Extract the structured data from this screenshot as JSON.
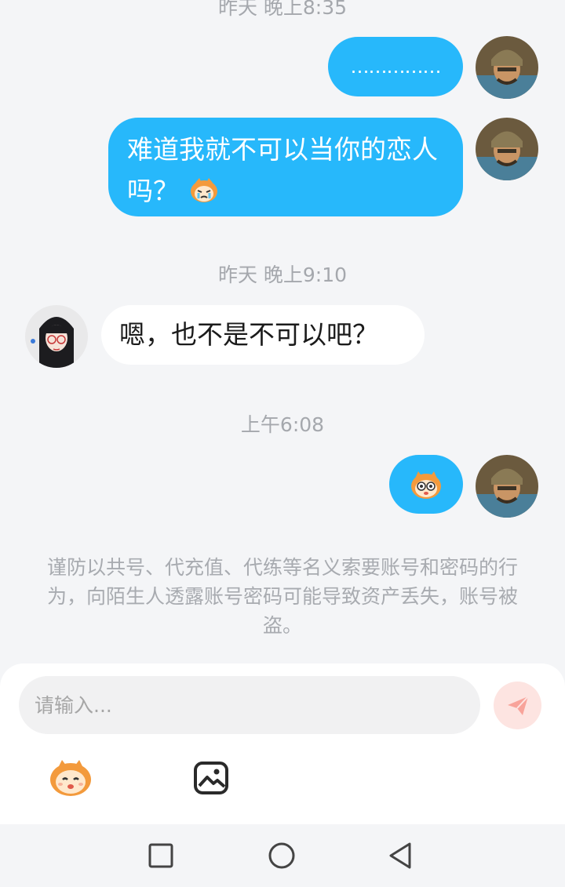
{
  "messages": {
    "ts1": "昨天 晚上8:35",
    "m1_text": "……………",
    "m2_text": "难道我就不可以当你的恋人吗？",
    "ts2": "昨天 晚上9:10",
    "m3_text": "嗯，也不是不可以吧？",
    "ts3": "上午6:08"
  },
  "notice": "谨防以共号、代充值、代练等名义索要账号和密码的行为，向陌生人透露账号密码可能导致资产丢失，账号被盗。",
  "composer": {
    "placeholder": "请输入..."
  },
  "colors": {
    "bubble_out": "#27b8fb",
    "send_bg": "#fde4e1",
    "send_icon": "#f8a39a"
  },
  "icons": [
    "general-avatar",
    "girl-avatar",
    "monkey-emoji",
    "send-icon",
    "emoji-button-icon",
    "image-icon",
    "square-icon",
    "circle-icon",
    "back-triangle-icon"
  ]
}
